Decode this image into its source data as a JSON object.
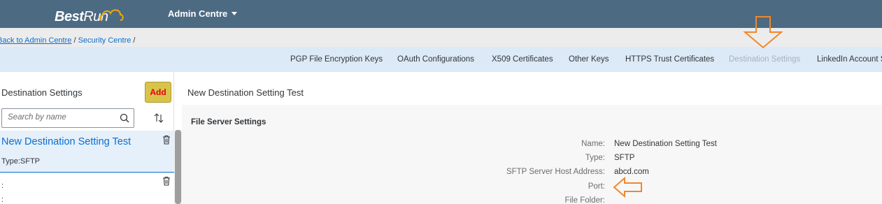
{
  "header": {
    "logo": {
      "bold": "Best",
      "regular": "Run"
    },
    "app_menu_label": "Admin Centre"
  },
  "breadcrumb": {
    "back_link": "Back to Admin Centre",
    "separator1": " / ",
    "security_link": "Security Centre",
    "separator2": " /"
  },
  "tabs": [
    {
      "label": "PGP File Encryption Keys",
      "state": "normal"
    },
    {
      "label": "OAuth Configurations",
      "state": "normal"
    },
    {
      "label": "X509 Certificates",
      "state": "normal"
    },
    {
      "label": "Other Keys",
      "state": "normal"
    },
    {
      "label": "HTTPS Trust Certificates",
      "state": "normal"
    },
    {
      "label": "Destination Settings",
      "state": "selected-disabled"
    },
    {
      "label": "LinkedIn Account S",
      "state": "normal"
    }
  ],
  "left_panel": {
    "title": "Destination Settings",
    "add_label": "Add",
    "search_placeholder": "Search by name",
    "items": [
      {
        "title": "New Destination Setting Test",
        "type": "Type:SFTP",
        "selected": true
      },
      {
        "title": ":",
        "type": ":",
        "selected": false
      }
    ]
  },
  "detail": {
    "title": "New Destination Setting Test",
    "section_title": "File Server Settings",
    "fields": [
      {
        "label": "Name:",
        "value": "New Destination Setting Test"
      },
      {
        "label": "Type:",
        "value": "SFTP"
      },
      {
        "label": "SFTP Server Host Address:",
        "value": "abcd.com"
      },
      {
        "label": "Port:",
        "value": ""
      },
      {
        "label": "File Folder:",
        "value": ""
      }
    ]
  },
  "colors": {
    "shell": "#4d6a83",
    "tabbar": "#dce9f6",
    "accent": "#0a6ed1",
    "add_button": "#d8c44a",
    "annotation_arrow": "#f0882b"
  },
  "icons": {
    "search": "search-icon",
    "sort": "sort-icon",
    "trash": "trash-icon",
    "annotation": "arrow-annotation"
  }
}
